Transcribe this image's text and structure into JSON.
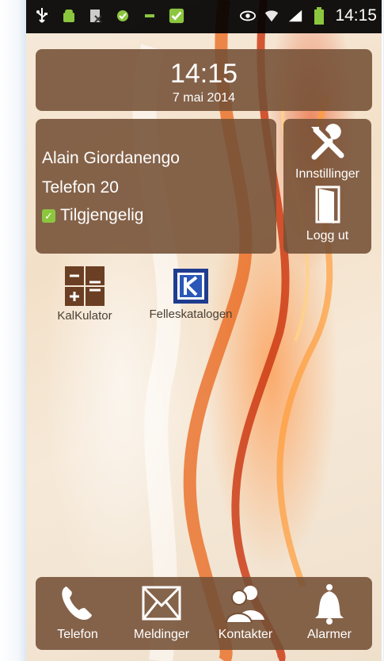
{
  "status_bar": {
    "time": "14:15",
    "icons_left": [
      "usb-icon",
      "android-icon",
      "screenshot-icon",
      "check-circle-icon",
      "battery-small-icon",
      "app-check-icon"
    ],
    "icons_right": [
      "eye-icon",
      "wifi-icon",
      "signal-icon",
      "battery-icon"
    ]
  },
  "clock_widget": {
    "time": "14:15",
    "date": "7 mai 2014"
  },
  "user_widget": {
    "name": "Alain Giordanengo",
    "phone": "Telefon 20",
    "status": "Tilgjengelig"
  },
  "side_panel": {
    "settings_label": "Innstillinger",
    "logout_label": "Logg ut"
  },
  "apps": [
    {
      "label": "KalKulator",
      "icon": "calculator-icon"
    },
    {
      "label": "Felleskatalogen",
      "icon": "felleskatalogen-icon"
    }
  ],
  "dock": [
    {
      "label": "Telefon",
      "icon": "phone-icon"
    },
    {
      "label": "Meldinger",
      "icon": "envelope-icon"
    },
    {
      "label": "Kontakter",
      "icon": "contacts-icon"
    },
    {
      "label": "Alarmer",
      "icon": "bell-icon"
    }
  ],
  "colors": {
    "panel": "#745036",
    "status_bar": "#000000",
    "accent_green": "#8cc63f"
  }
}
